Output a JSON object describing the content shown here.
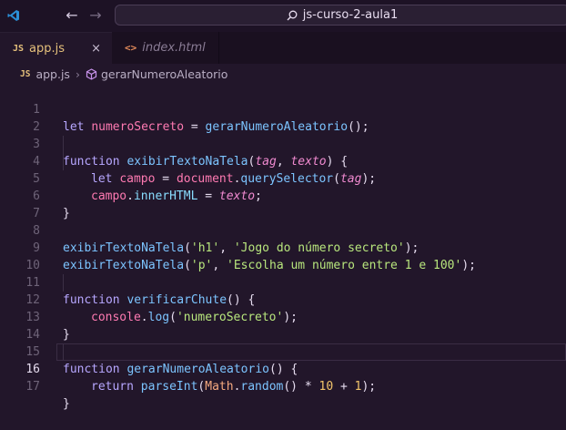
{
  "titlebar": {
    "search_text": "js-curso-2-aula1",
    "back_icon": "arrow-left-icon",
    "forward_icon": "arrow-right-icon"
  },
  "tabs": [
    {
      "badge": "JS",
      "label": "app.js",
      "active": true
    },
    {
      "badge": "<>",
      "label": "index.html",
      "active": false
    }
  ],
  "tab_close_glyph": "×",
  "breadcrumb": {
    "badge": "JS",
    "file": "app.js",
    "separator": "›",
    "symbol": "gerarNumeroAleatorio"
  },
  "editor": {
    "current_line": 16,
    "line_numbers": [
      "1",
      "2",
      "3",
      "4",
      "5",
      "6",
      "7",
      "8",
      "9",
      "10",
      "11",
      "12",
      "13",
      "14",
      "15",
      "16",
      "17"
    ],
    "tokens": {
      "let": "let",
      "numeroSecreto": "numeroSecreto",
      "eq": " = ",
      "gerarNumeroAleatorio": "gerarNumeroAleatorio",
      "callEnd": "();",
      "function": "function",
      "exibirTextoNaTela": "exibirTextoNaTela",
      "tag": "tag",
      "texto": "texto",
      "comma": ", ",
      "openParen": "(",
      "closeParenBrace": ") {",
      "campo": "campo",
      "document": "document",
      "dot": ".",
      "querySelector": "querySelector",
      "closeParenSemi": ");",
      "innerHTML": "innerHTML",
      "semi": ";",
      "closeBrace": "}",
      "h1": "'h1'",
      "jogo": "'Jogo do número secreto'",
      "p": "'p'",
      "escolha": "'Escolha um número entre 1 e 100'",
      "verificarChute": "verificarChute",
      "emptyParensBrace": "() {",
      "console": "console",
      "log": "log",
      "numeroSecretoStr": "'numeroSecreto'",
      "return": "return",
      "parseInt": "parseInt",
      "Math": "Math",
      "random": "random",
      "emptyParens": "()",
      "times": " * ",
      "ten": "10",
      "plus": " + ",
      "one": "1",
      "space": " "
    }
  }
}
